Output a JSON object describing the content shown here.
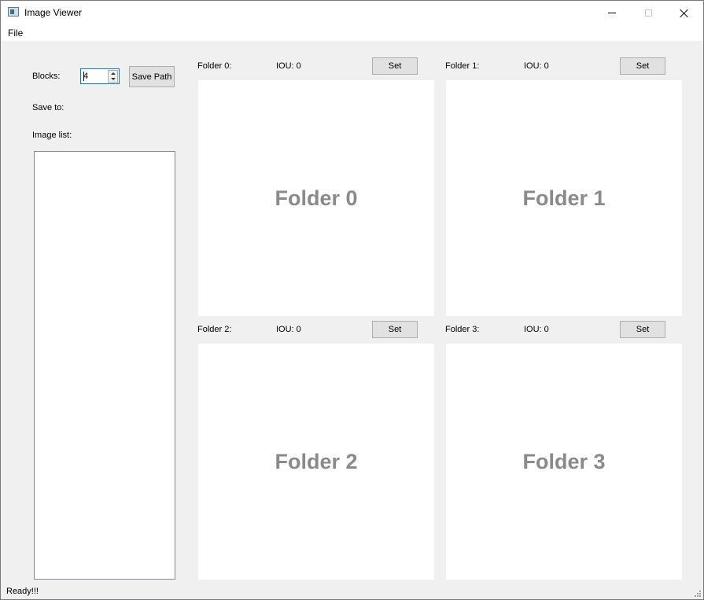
{
  "window": {
    "title": "Image Viewer",
    "controls": {
      "minimize": "minimize",
      "maximize": "maximize",
      "close": "close"
    }
  },
  "menu": {
    "items": [
      {
        "label": "File"
      }
    ]
  },
  "sidebar": {
    "blocks_label": "Blocks:",
    "blocks_value": "4",
    "save_path_button": "Save Path",
    "save_to_label": "Save to:",
    "image_list_label": "Image list:",
    "image_list_items": []
  },
  "folders": [
    {
      "label": "Folder 0:",
      "iou": "IOU: 0",
      "set_button": "Set",
      "panel_text": "Folder 0"
    },
    {
      "label": "Folder 1:",
      "iou": "IOU: 0",
      "set_button": "Set",
      "panel_text": "Folder 1"
    },
    {
      "label": "Folder 2:",
      "iou": "IOU: 0",
      "set_button": "Set",
      "panel_text": "Folder 2"
    },
    {
      "label": "Folder 3:",
      "iou": "IOU: 0",
      "set_button": "Set",
      "panel_text": "Folder 3"
    }
  ],
  "status": {
    "text": "Ready!!!"
  },
  "colors": {
    "window_bg": "#f0f0f0",
    "panel_bg": "#ffffff",
    "panel_text": "#8a8a8a",
    "focus_border": "#0078d7",
    "button_bg": "#e1e1e1"
  }
}
